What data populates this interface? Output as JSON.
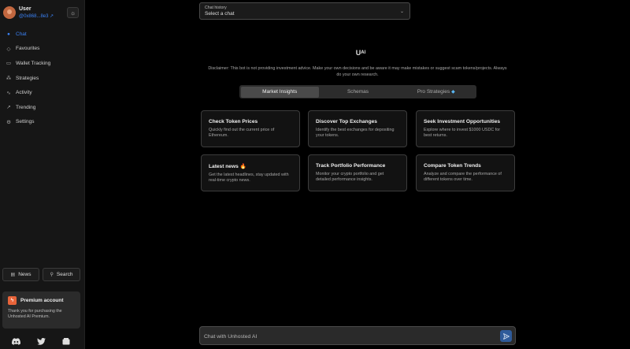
{
  "user": {
    "name": "User",
    "address": "@0x868...8e3"
  },
  "sidebar": {
    "items": [
      {
        "label": "Chat",
        "icon": "chat-bubble-icon",
        "active": true
      },
      {
        "label": "Favourites",
        "icon": "tag-icon"
      },
      {
        "label": "Wallet Tracking",
        "icon": "wallet-icon"
      },
      {
        "label": "Strategies",
        "icon": "strategy-icon"
      },
      {
        "label": "Activity",
        "icon": "activity-pulse-icon"
      },
      {
        "label": "Trending",
        "icon": "trending-up-icon"
      },
      {
        "label": "Settings",
        "icon": "gear-icon"
      }
    ],
    "news_label": "News",
    "search_label": "Search"
  },
  "premium": {
    "title": "Premium account",
    "description": "Thank you for purchasing the Unhosted AI Premium."
  },
  "chat_history": {
    "label": "Chat history",
    "value": "Select a chat"
  },
  "logo_text": "Uᴬᴵ",
  "disclaimer": "Disclaimer: This bot is not providing investment advice. Make your own decisions and be aware it may make mistakes or suggest scam tokens/projects. Always do your own research.",
  "tabs": [
    {
      "label": "Market Insights",
      "active": true
    },
    {
      "label": "Schemas"
    },
    {
      "label": "Pro Strategies"
    }
  ],
  "cards": [
    {
      "title": "Check Token Prices",
      "description": "Quickly find out the current price of Ethereum."
    },
    {
      "title": "Discover Top Exchanges",
      "description": "Identify the best exchanges for depositing your tokens."
    },
    {
      "title": "Seek Investment Opportunities",
      "description": "Explore where to invest $1000 USDC for best returns."
    },
    {
      "title": "Latest news 🔥",
      "description": "Get the latest headlines, stay updated with real-time crypto news."
    },
    {
      "title": "Track Portfolio Performance",
      "description": "Monitor your crypto portfolio and get detailed performance insights."
    },
    {
      "title": "Compare Token Trends",
      "description": "Analyze and compare the performance of different tokens over time."
    }
  ],
  "chat_input": {
    "placeholder": "Chat with Unhosted AI"
  },
  "colors": {
    "accent": "#3b82f6",
    "premium_icon": "#e8643a",
    "avatar": "#c2673f"
  }
}
